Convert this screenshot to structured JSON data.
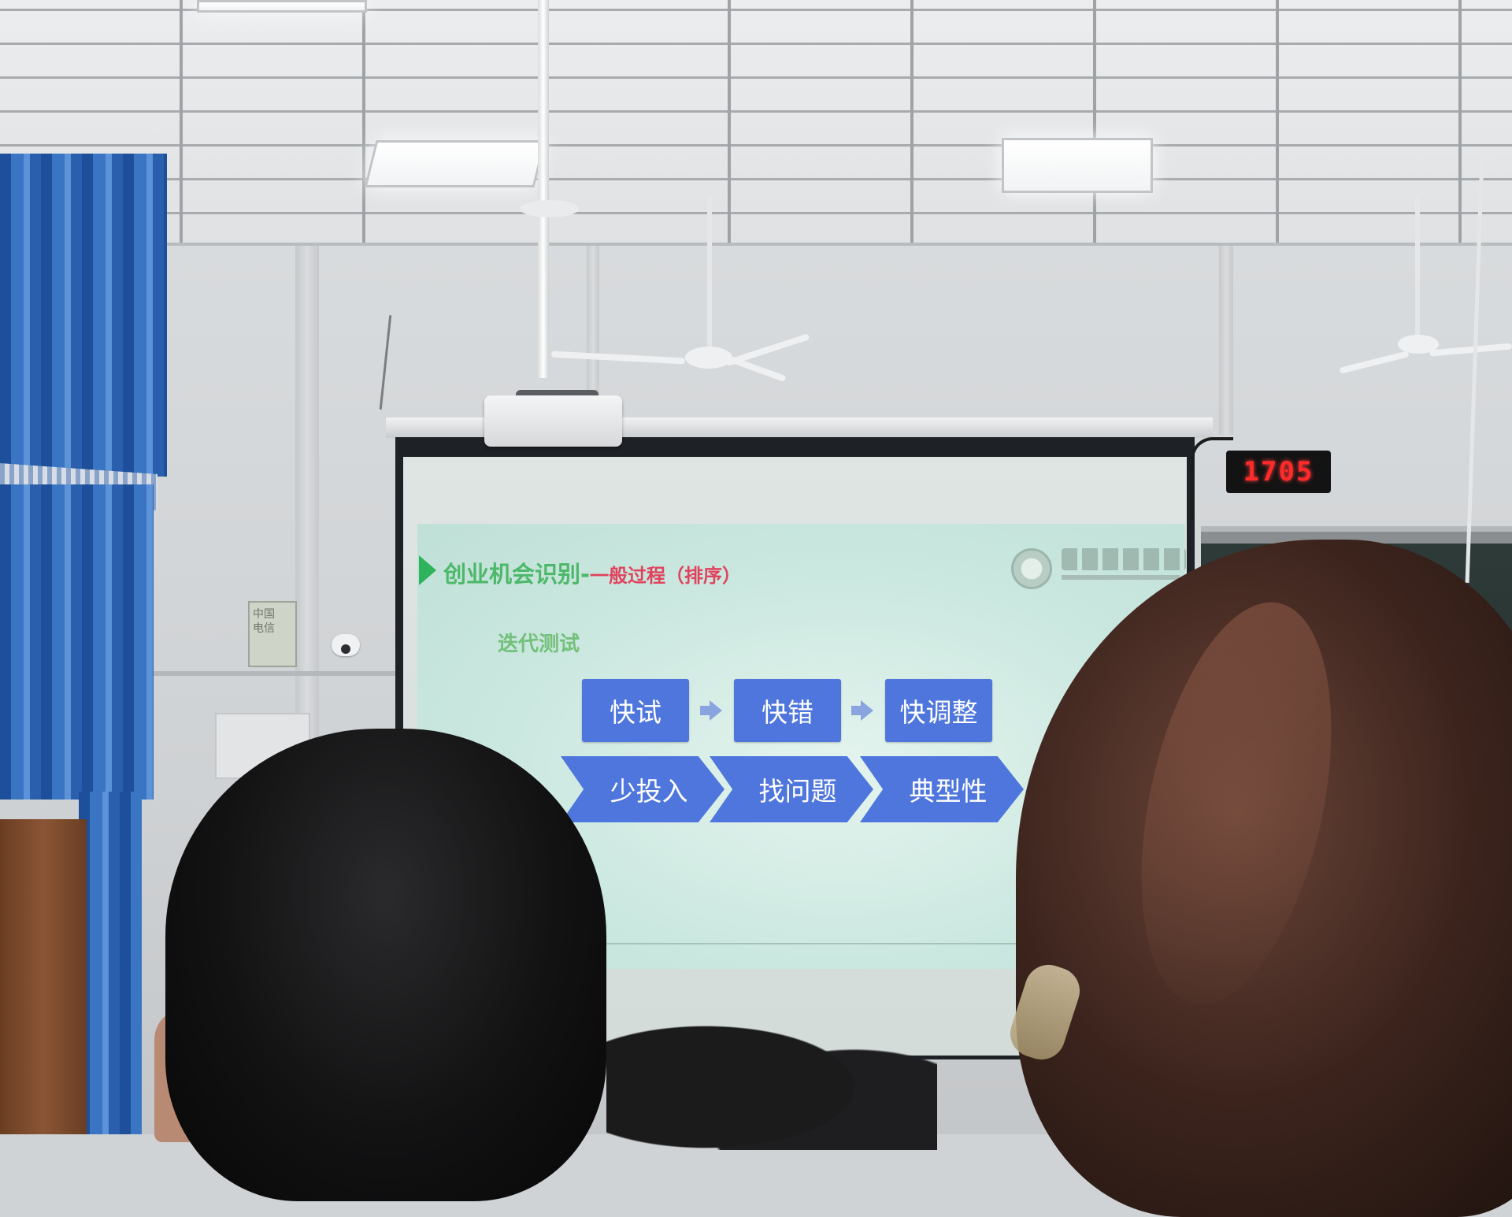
{
  "scene": {
    "description_colors": {
      "curtain": "#2f66b5",
      "box_blue": "#4f76dc",
      "title_green": "#4db86a",
      "title_red": "#e0445d",
      "clock_red": "#ff2a2a"
    }
  },
  "slide": {
    "title": "创业机会识别-",
    "title_sub": "一般过程（排序）",
    "subtitle": "迭代测试",
    "top_boxes": [
      "快试",
      "快错",
      "快调整"
    ],
    "chevrons": [
      "少投入",
      "找问题",
      "典型性"
    ]
  },
  "clock": {
    "time": "1705"
  },
  "wall_panel": {
    "label_line1": "中国",
    "label_line2": "电信"
  }
}
